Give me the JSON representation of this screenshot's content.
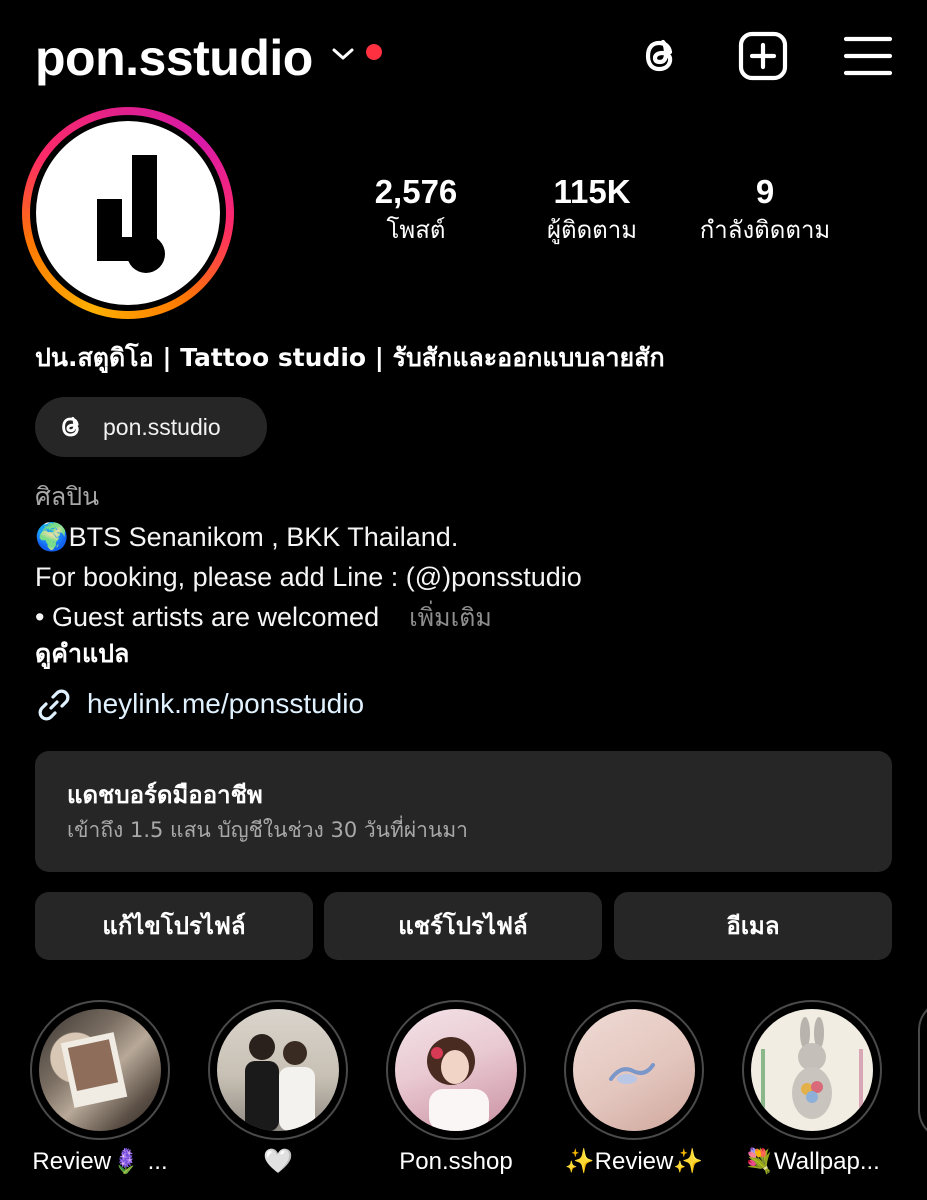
{
  "header": {
    "username": "pon.sstudio",
    "icons": [
      "chevron-down-icon",
      "notification-dot",
      "threads-icon",
      "new-post-icon",
      "menu-icon"
    ],
    "notification_color": "#ff3040"
  },
  "profile": {
    "avatar_alt": "pon.sstudio logo",
    "stats": [
      {
        "value": "2,576",
        "label": "โพสต์"
      },
      {
        "value": "115K",
        "label": "ผู้ติดตาม"
      },
      {
        "value": "9",
        "label": "กำลังติดตาม"
      }
    ],
    "full_name": "ปน.สตูดิโอ | Tattoo studio | รับสักและออกแบบลายสัก",
    "threads_handle": "pon.sstudio",
    "category": "ศิลปิน",
    "bio_lines": [
      "🌍BTS Senanikom , BKK Thailand.",
      "For booking, please add Line : (@)ponsstudio",
      "• Guest artists are welcomed"
    ],
    "more_label": "เพิ่มเติม",
    "translate_label": "ดูคำแปล",
    "link": "heylink.me/ponsstudio"
  },
  "dashboard": {
    "title": "แดชบอร์ดมืออาชีพ",
    "subtitle": "เข้าถึง 1.5 แสน บัญชีในช่วง 30 วันที่ผ่านมา"
  },
  "actions": {
    "edit_profile": "แก้ไขโปรไฟล์",
    "share_profile": "แชร์โปรไฟล์",
    "email": "อีเมล"
  },
  "highlights": [
    {
      "label": "Review🪻 ..."
    },
    {
      "label": "🤍"
    },
    {
      "label": "Pon.sshop"
    },
    {
      "label": "✨Review✨"
    },
    {
      "label": "💐Wallpap..."
    }
  ],
  "colors": {
    "background": "#000000",
    "surface": "#262626",
    "secondary_text": "#a8a8a8",
    "link_text": "#e0f1ff",
    "story_ring": [
      "#ffb000",
      "#ff2a68",
      "#d91aa8"
    ]
  }
}
